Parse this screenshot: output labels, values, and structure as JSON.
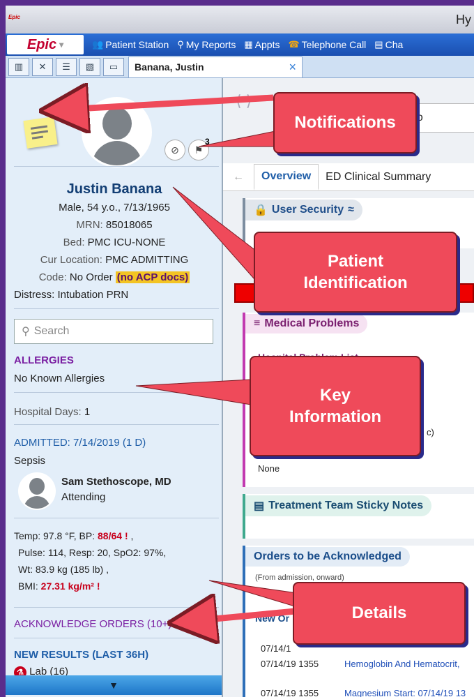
{
  "titlebar": {
    "logo": "Epic",
    "title": "Hy"
  },
  "menubar": {
    "epic_label": "Epic",
    "items": [
      {
        "label": "Patient Station",
        "icon": "patient-station-icon"
      },
      {
        "label": "My Reports",
        "icon": "search-icon"
      },
      {
        "label": "Appts",
        "icon": "appointments-icon"
      },
      {
        "label": "Telephone Call",
        "icon": "phone-icon"
      },
      {
        "label": "Cha",
        "icon": "chart-icon"
      }
    ]
  },
  "tabstrip": {
    "patient_tab": "Banana, Justin",
    "close": "×"
  },
  "patient": {
    "name": "Justin Banana",
    "demographics": "Male, 54 y.o., 7/13/1965",
    "mrn_label": "MRN:",
    "mrn": "85018065",
    "bed_label": "Bed:",
    "bed": "PMC ICU-NONE",
    "location_label": "Cur Location:",
    "location": "PMC ADMITTING",
    "code_label": "Code:",
    "code": "No Order",
    "acp": "(no ACP docs)",
    "distress_label": "Distress:",
    "distress": "Intubation PRN",
    "notification_count": "3"
  },
  "sidebar": {
    "search_placeholder": "Search",
    "allergies_header": "ALLERGIES",
    "allergies_value": "No Known Allergies",
    "hospital_days_label": "Hospital Days:",
    "hospital_days": "1",
    "admitted_header": "ADMITTED: 7/14/2019 (1 D)",
    "admit_reason": "Sepsis",
    "provider_name": "Sam Stethoscope, MD",
    "provider_role": "Attending",
    "vitals": {
      "temp_label": "Temp:",
      "temp": "97.8 °F",
      "bp_label": "BP:",
      "bp": "88/64",
      "pulse_label": "Pulse:",
      "pulse": "114",
      "resp_label": "Resp:",
      "resp": "20",
      "spo2_label": "SpO2:",
      "spo2": "97%",
      "wt_label": "Wt:",
      "wt": "83.9 kg",
      "wt_lb": "(185 lb)",
      "bmi_label": "BMI:",
      "bmi": "27.31 kg/m²"
    },
    "ack_orders": "ACKNOWLEDGE ORDERS (10+)",
    "new_results": "NEW RESULTS (LAST 36H)",
    "lab": "Lab (16)"
  },
  "main": {
    "workspace_tab": "Wo",
    "subtabs": [
      "Overview",
      "ED Clinical Summary"
    ],
    "user_security": "User Security",
    "medical_problems": "Medical Problems",
    "hospital_problem_list": "Hospital Problem List",
    "none": "None",
    "fragment_c": "c)",
    "treatment_team": "Treatment Team Sticky Notes",
    "orders_title": "Orders to be Acknowledged",
    "orders_sub": "(From admission, onward)",
    "new_orders": "New Or",
    "orders": [
      {
        "time": "07/14/1",
        "desc": ""
      },
      {
        "time": "07/14/19 1355",
        "desc": "Hemoglobin And Hematocrit,"
      },
      {
        "time": "07/14/19 1355",
        "desc": "Magnesium Start: 07/14/19 13"
      }
    ]
  },
  "callouts": {
    "notifications": "Notifications",
    "patient_identification_1": "Patient",
    "patient_identification_2": "Identification",
    "key_information_1": "Key",
    "key_information_2": "Information",
    "details": "Details"
  },
  "colors": {
    "callout": "#ef4a5a",
    "accent": "#1f5ea8",
    "alert": "#c8001c"
  }
}
